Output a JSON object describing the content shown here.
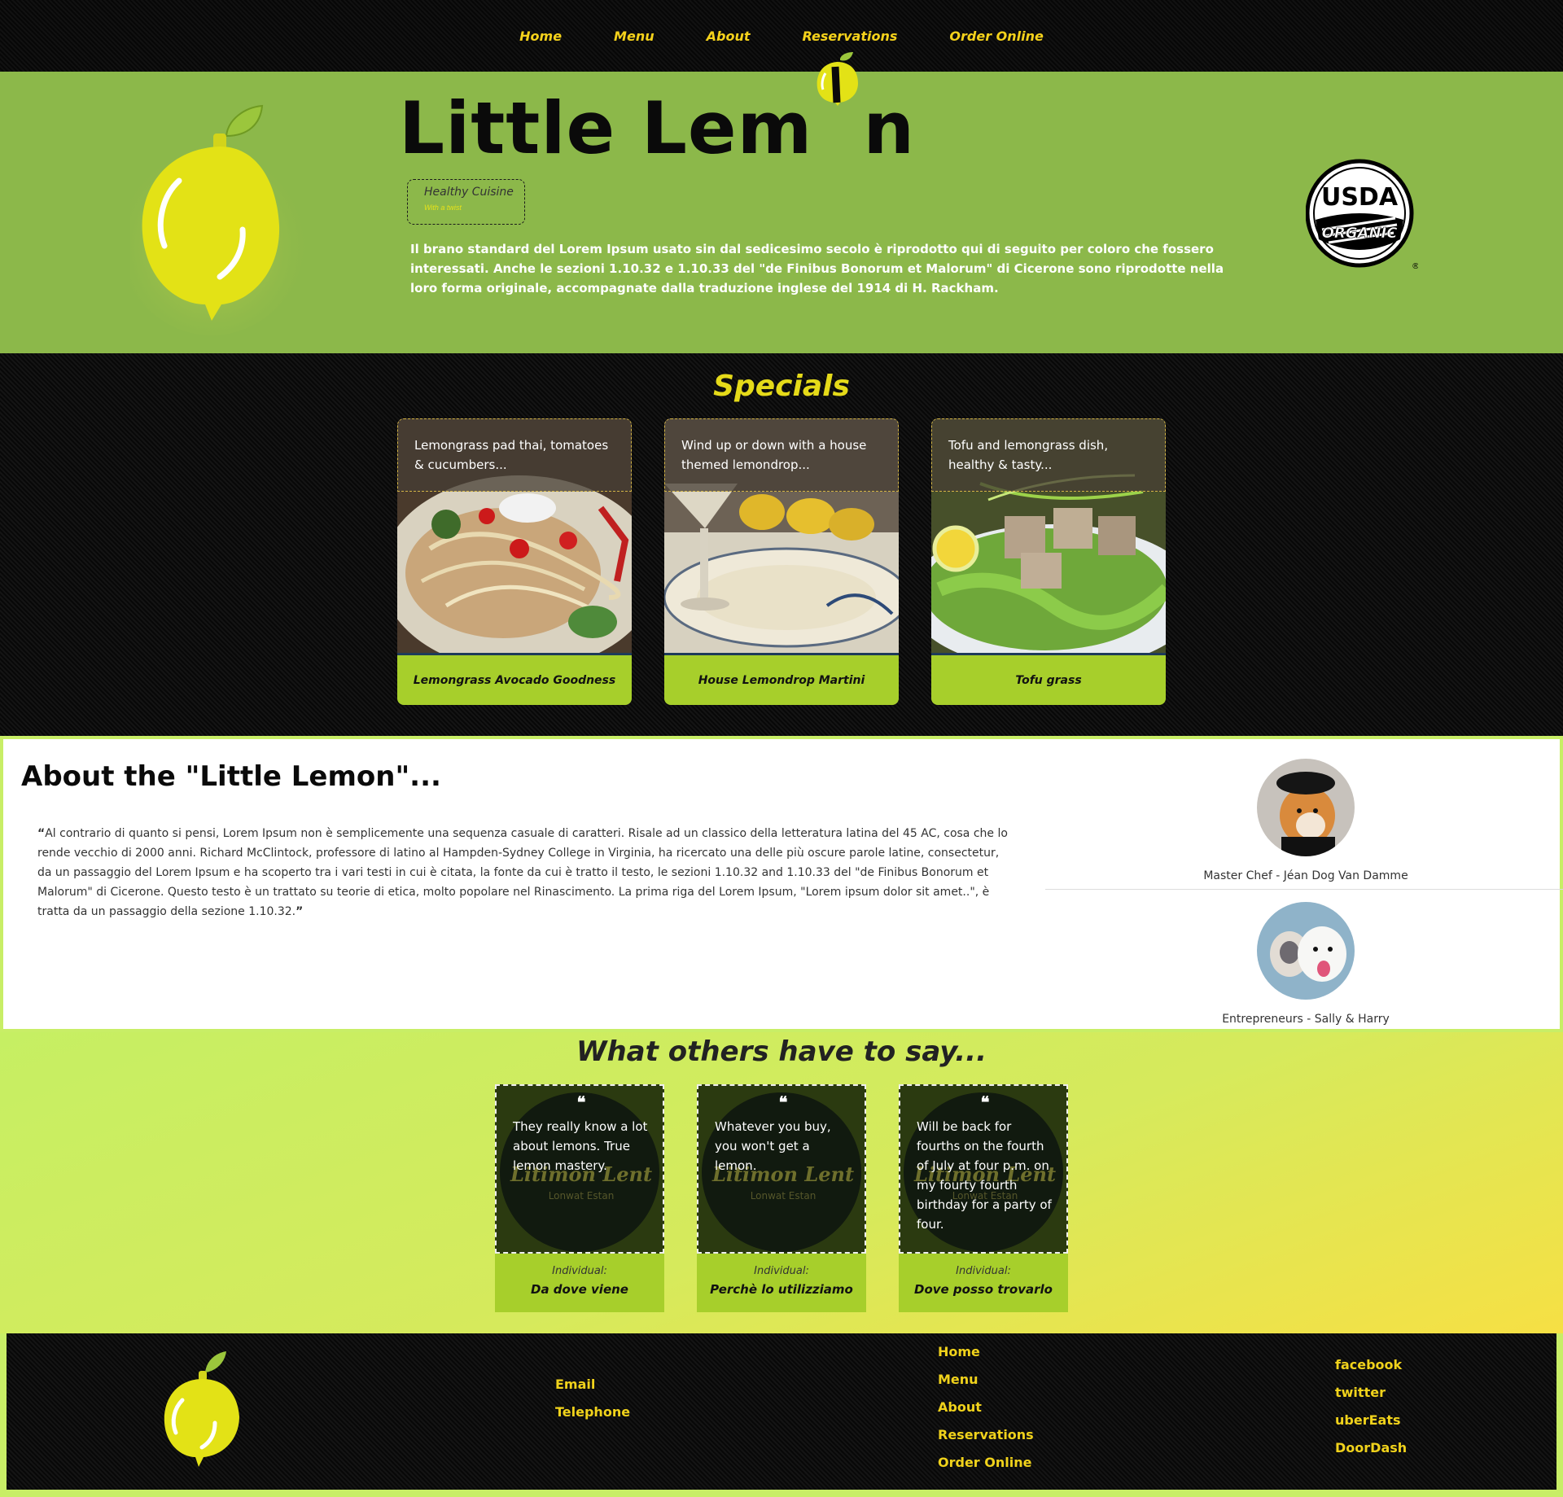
{
  "nav": {
    "items": [
      "Home",
      "Menu",
      "About",
      "Reservations",
      "Order Online"
    ]
  },
  "hero": {
    "title_part1": "Little Lem",
    "title_part2": "n",
    "tagline": "Healthy Cuisine",
    "tagline_sub": "With a twist",
    "text": "Il brano standard del Lorem Ipsum usato sin dal sedicesimo secolo è riprodotto qui di seguito per coloro che fossero interessati. Anche le sezioni 1.10.32 e 1.10.33 del \"de Finibus Bonorum et Malorum\" di Cicerone sono riprodotte nella loro forma originale, accompagnate dalla traduzione inglese del 1914 di H. Rackham.",
    "badge_top": "USDA",
    "badge_bottom": "ORGANIC",
    "badge_mark": "®"
  },
  "specials": {
    "title": "Specials",
    "cards": [
      {
        "desc": "Lemongrass pad thai, tomatoes & cucumbers...",
        "name": "Lemongrass Avocado Goodness"
      },
      {
        "desc": "Wind up or down with a house themed lemondrop...",
        "name": "House Lemondrop Martini"
      },
      {
        "desc": "Tofu and lemongrass dish, healthy & tasty...",
        "name": "Tofu grass"
      }
    ]
  },
  "about": {
    "title": "About the \"Little Lemon\"...",
    "quote": "Al contrario di quanto si pensi, Lorem Ipsum non è semplicemente una sequenza casuale di caratteri. Risale ad un classico della letteratura latina del 45 AC, cosa che lo rende vecchio di 2000 anni. Richard McClintock, professore di latino al Hampden-Sydney College in Virginia, ha ricercato una delle più oscure parole latine, consectetur, da un passaggio del Lorem Ipsum e ha scoperto tra i vari testi in cui è citata, la fonte da cui è tratto il testo, le sezioni 1.10.32 and 1.10.33 del \"de Finibus Bonorum et Malorum\" di Cicerone. Questo testo è un trattato su teorie di etica, molto popolare nel Rinascimento. La prima riga del Lorem Ipsum, \"Lorem ipsum dolor sit amet..\", è tratta da un passaggio della sezione 1.10.32.",
    "people": [
      {
        "caption": "Master Chef - Jéan Dog Van Damme"
      },
      {
        "caption": "Entrepreneurs - Sally & Harry"
      }
    ]
  },
  "testimonials": {
    "title": "What others have to say...",
    "brand": "Litimon Lent",
    "brand_sub": "Lonwat Estan",
    "cards": [
      {
        "text": "They really know a lot about lemons. True lemon mastery.",
        "label": "Individual:",
        "who": "Da dove viene"
      },
      {
        "text": "Whatever you buy, you won't get a lemon.",
        "label": "Individual:",
        "who": "Perchè lo utilizziamo"
      },
      {
        "text": "Will be back for fourths on the fourth of July at four p.m. on my fourty fourth birthday for a party of four.",
        "label": "Individual:",
        "who": "Dove posso trovarlo"
      }
    ]
  },
  "footer": {
    "contact": [
      "Email",
      "Telephone"
    ],
    "nav": [
      "Home",
      "Menu",
      "About",
      "Reservations",
      "Order Online"
    ],
    "social": [
      "facebook",
      "twitter",
      "uberEats",
      "DoorDash"
    ]
  },
  "colors": {
    "accent_yellow": "#f5d21b",
    "hero_green": "#8cb84a",
    "card_green": "#a7cf2b",
    "background_green": "#c8ee66"
  }
}
